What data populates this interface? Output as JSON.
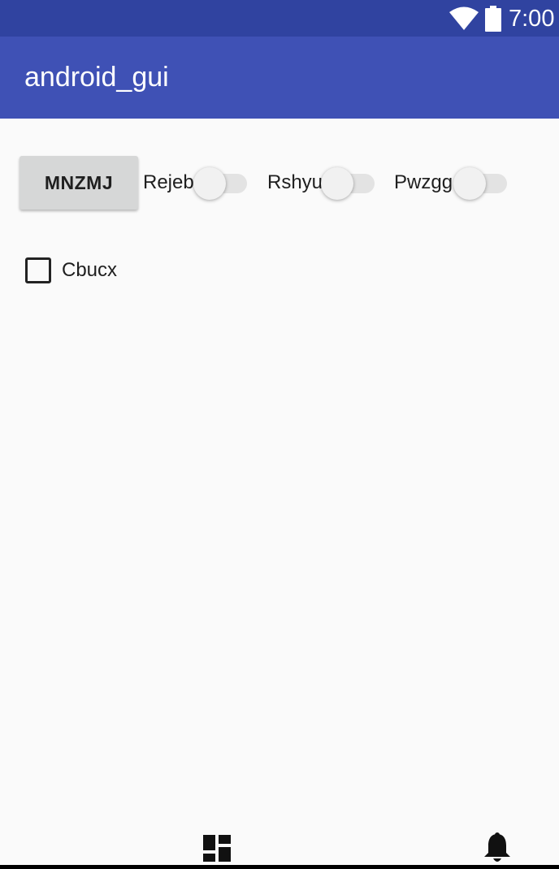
{
  "status_bar": {
    "time": "7:00",
    "icons": [
      "wifi-icon",
      "battery-icon"
    ],
    "color": "#3043a0"
  },
  "app_bar": {
    "title": "android_gui",
    "color": "#3f51b5"
  },
  "controls": {
    "button_label": "MNZMJ",
    "switches": [
      {
        "label": "Rejeb",
        "checked": false
      },
      {
        "label": "Rshyu",
        "checked": false
      },
      {
        "label": "Pwzgg",
        "checked": false
      }
    ],
    "checkbox": {
      "label": "Cbucx",
      "checked": false
    }
  },
  "bottom_nav": {
    "icons": [
      "dashboard-icon",
      "notifications-icon"
    ]
  }
}
